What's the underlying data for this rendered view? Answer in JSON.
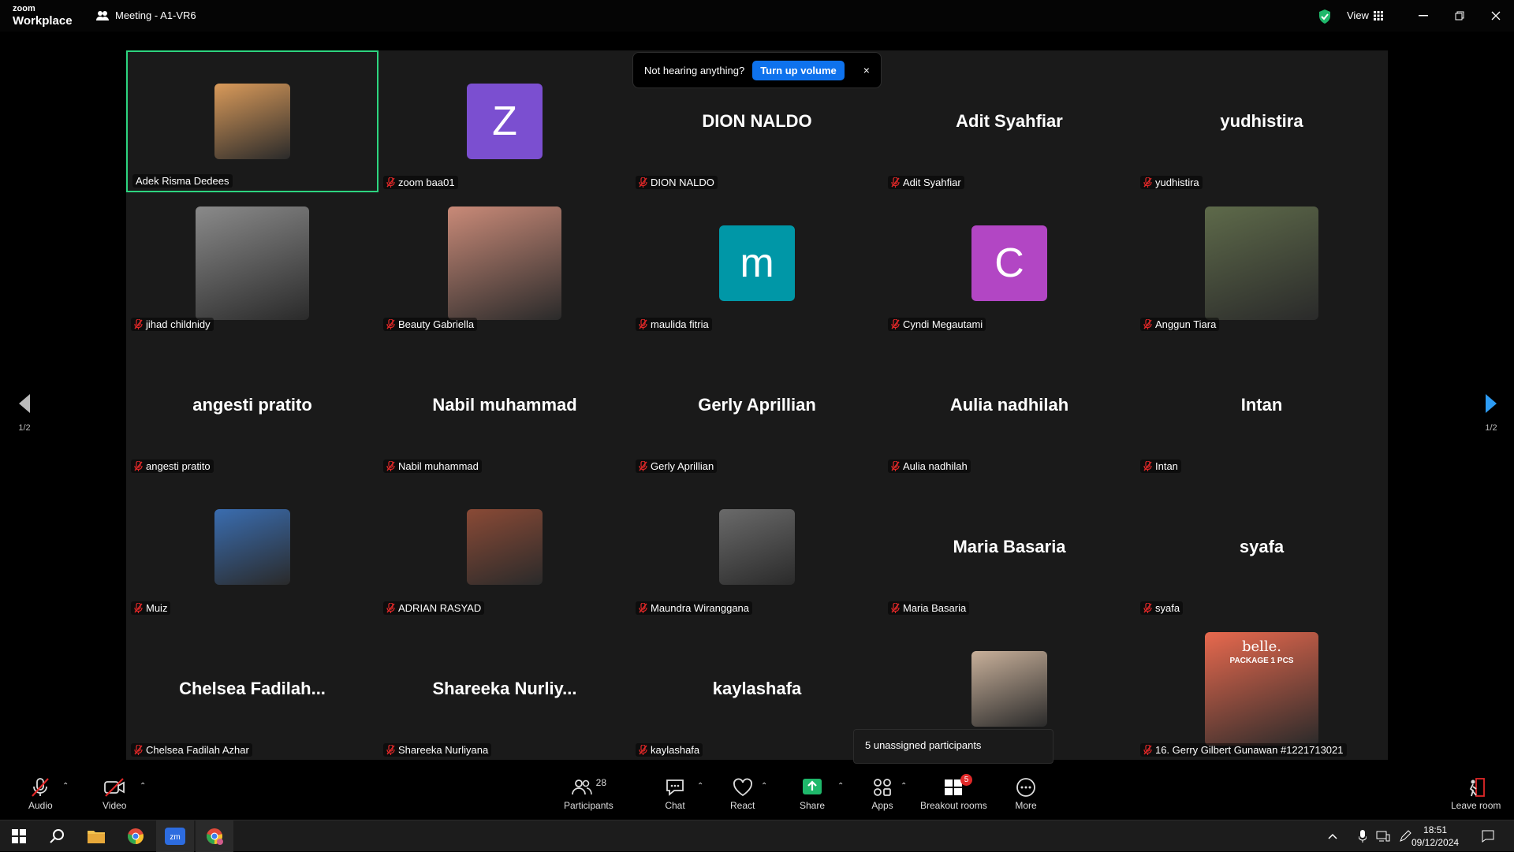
{
  "app": {
    "logo_top": "zoom",
    "logo_bottom": "Workplace",
    "meeting_title": "Meeting - A1-VR6",
    "view_label": "View"
  },
  "toast": {
    "message": "Not hearing anything?",
    "button": "Turn up volume",
    "close": "×"
  },
  "pager": {
    "left": "1/2",
    "right": "1/2"
  },
  "popover": {
    "text": "5 unassigned participants"
  },
  "participants": [
    {
      "name": "Adek Risma Dedees",
      "display": "photo",
      "muted": false,
      "active": true,
      "color": "#d99a5a"
    },
    {
      "name": "zoom baa01",
      "display": "letter",
      "letter": "Z",
      "color": "#7b4fd0",
      "muted": true
    },
    {
      "name": "DION NALDO",
      "display": "text",
      "big": "DION NALDO",
      "muted": true
    },
    {
      "name": "Adit Syahfiar",
      "display": "text",
      "big": "Adit Syahfiar",
      "muted": true
    },
    {
      "name": "yudhistira",
      "display": "text",
      "big": "yudhistira",
      "muted": true
    },
    {
      "name": "jihad childnidy",
      "display": "photo-big",
      "color": "#8a8a8a",
      "muted": true
    },
    {
      "name": "Beauty Gabriella",
      "display": "photo-big",
      "color": "#c98a78",
      "muted": true
    },
    {
      "name": "maulida fitria",
      "display": "letter",
      "letter": "m",
      "color": "#0097a7",
      "muted": true
    },
    {
      "name": "Cyndi Megautami",
      "display": "letter",
      "letter": "C",
      "color": "#b246c4",
      "muted": true
    },
    {
      "name": "Anggun Tiara",
      "display": "photo-big",
      "color": "#5e6a4a",
      "muted": true
    },
    {
      "name": "angesti pratito",
      "display": "text",
      "big": "angesti pratito",
      "muted": true
    },
    {
      "name": "Nabil muhammad",
      "display": "text",
      "big": "Nabil muhammad",
      "muted": true
    },
    {
      "name": "Gerly Aprillian",
      "display": "text",
      "big": "Gerly Aprillian",
      "muted": true
    },
    {
      "name": "Aulia nadhilah",
      "display": "text",
      "big": "Aulia nadhilah",
      "muted": true
    },
    {
      "name": "Intan",
      "display": "text",
      "big": "Intan",
      "muted": true
    },
    {
      "name": "Muiz",
      "display": "photo",
      "color": "#3a6db0",
      "muted": true
    },
    {
      "name": "ADRIAN RASYAD",
      "display": "photo",
      "color": "#8a4a36",
      "muted": true
    },
    {
      "name": "Maundra Wiranggana",
      "display": "photo",
      "color": "#6a6a6a",
      "muted": true
    },
    {
      "name": "Maria Basaria",
      "display": "text",
      "big": "Maria Basaria",
      "muted": true
    },
    {
      "name": "syafa",
      "display": "text",
      "big": "syafa",
      "muted": true
    },
    {
      "name": "Chelsea Fadilah Azhar",
      "display": "text",
      "big": "Chelsea  Fadilah...",
      "muted": true
    },
    {
      "name": "Shareeka Nurliyana",
      "display": "text",
      "big": "Shareeka  Nurliy...",
      "muted": true
    },
    {
      "name": "kaylashafa",
      "display": "text",
      "big": "kaylashafa",
      "muted": true
    },
    {
      "name": "",
      "display": "photo",
      "color": "#c8b09a",
      "muted": false,
      "nolabel": true
    },
    {
      "name": "16. Gerry Gilbert Gunawan #1221713021",
      "display": "photo-big",
      "color": "#e8694e",
      "muted": true,
      "overlay": "belle.",
      "overlay2": "PACKAGE 1 PCS"
    }
  ],
  "toolbar": {
    "audio": "Audio",
    "video": "Video",
    "participants": "Participants",
    "participants_count": "28",
    "chat": "Chat",
    "react": "React",
    "share": "Share",
    "apps": "Apps",
    "breakout": "Breakout rooms",
    "breakout_badge": "5",
    "more": "More",
    "leave": "Leave room"
  },
  "taskbar": {
    "time": "18:51",
    "date": "09/12/2024"
  },
  "colors": {
    "accent": "#0e72ed",
    "active_border": "#2dd47f",
    "share_green": "#1fb86b",
    "muted_red": "#e02828"
  }
}
